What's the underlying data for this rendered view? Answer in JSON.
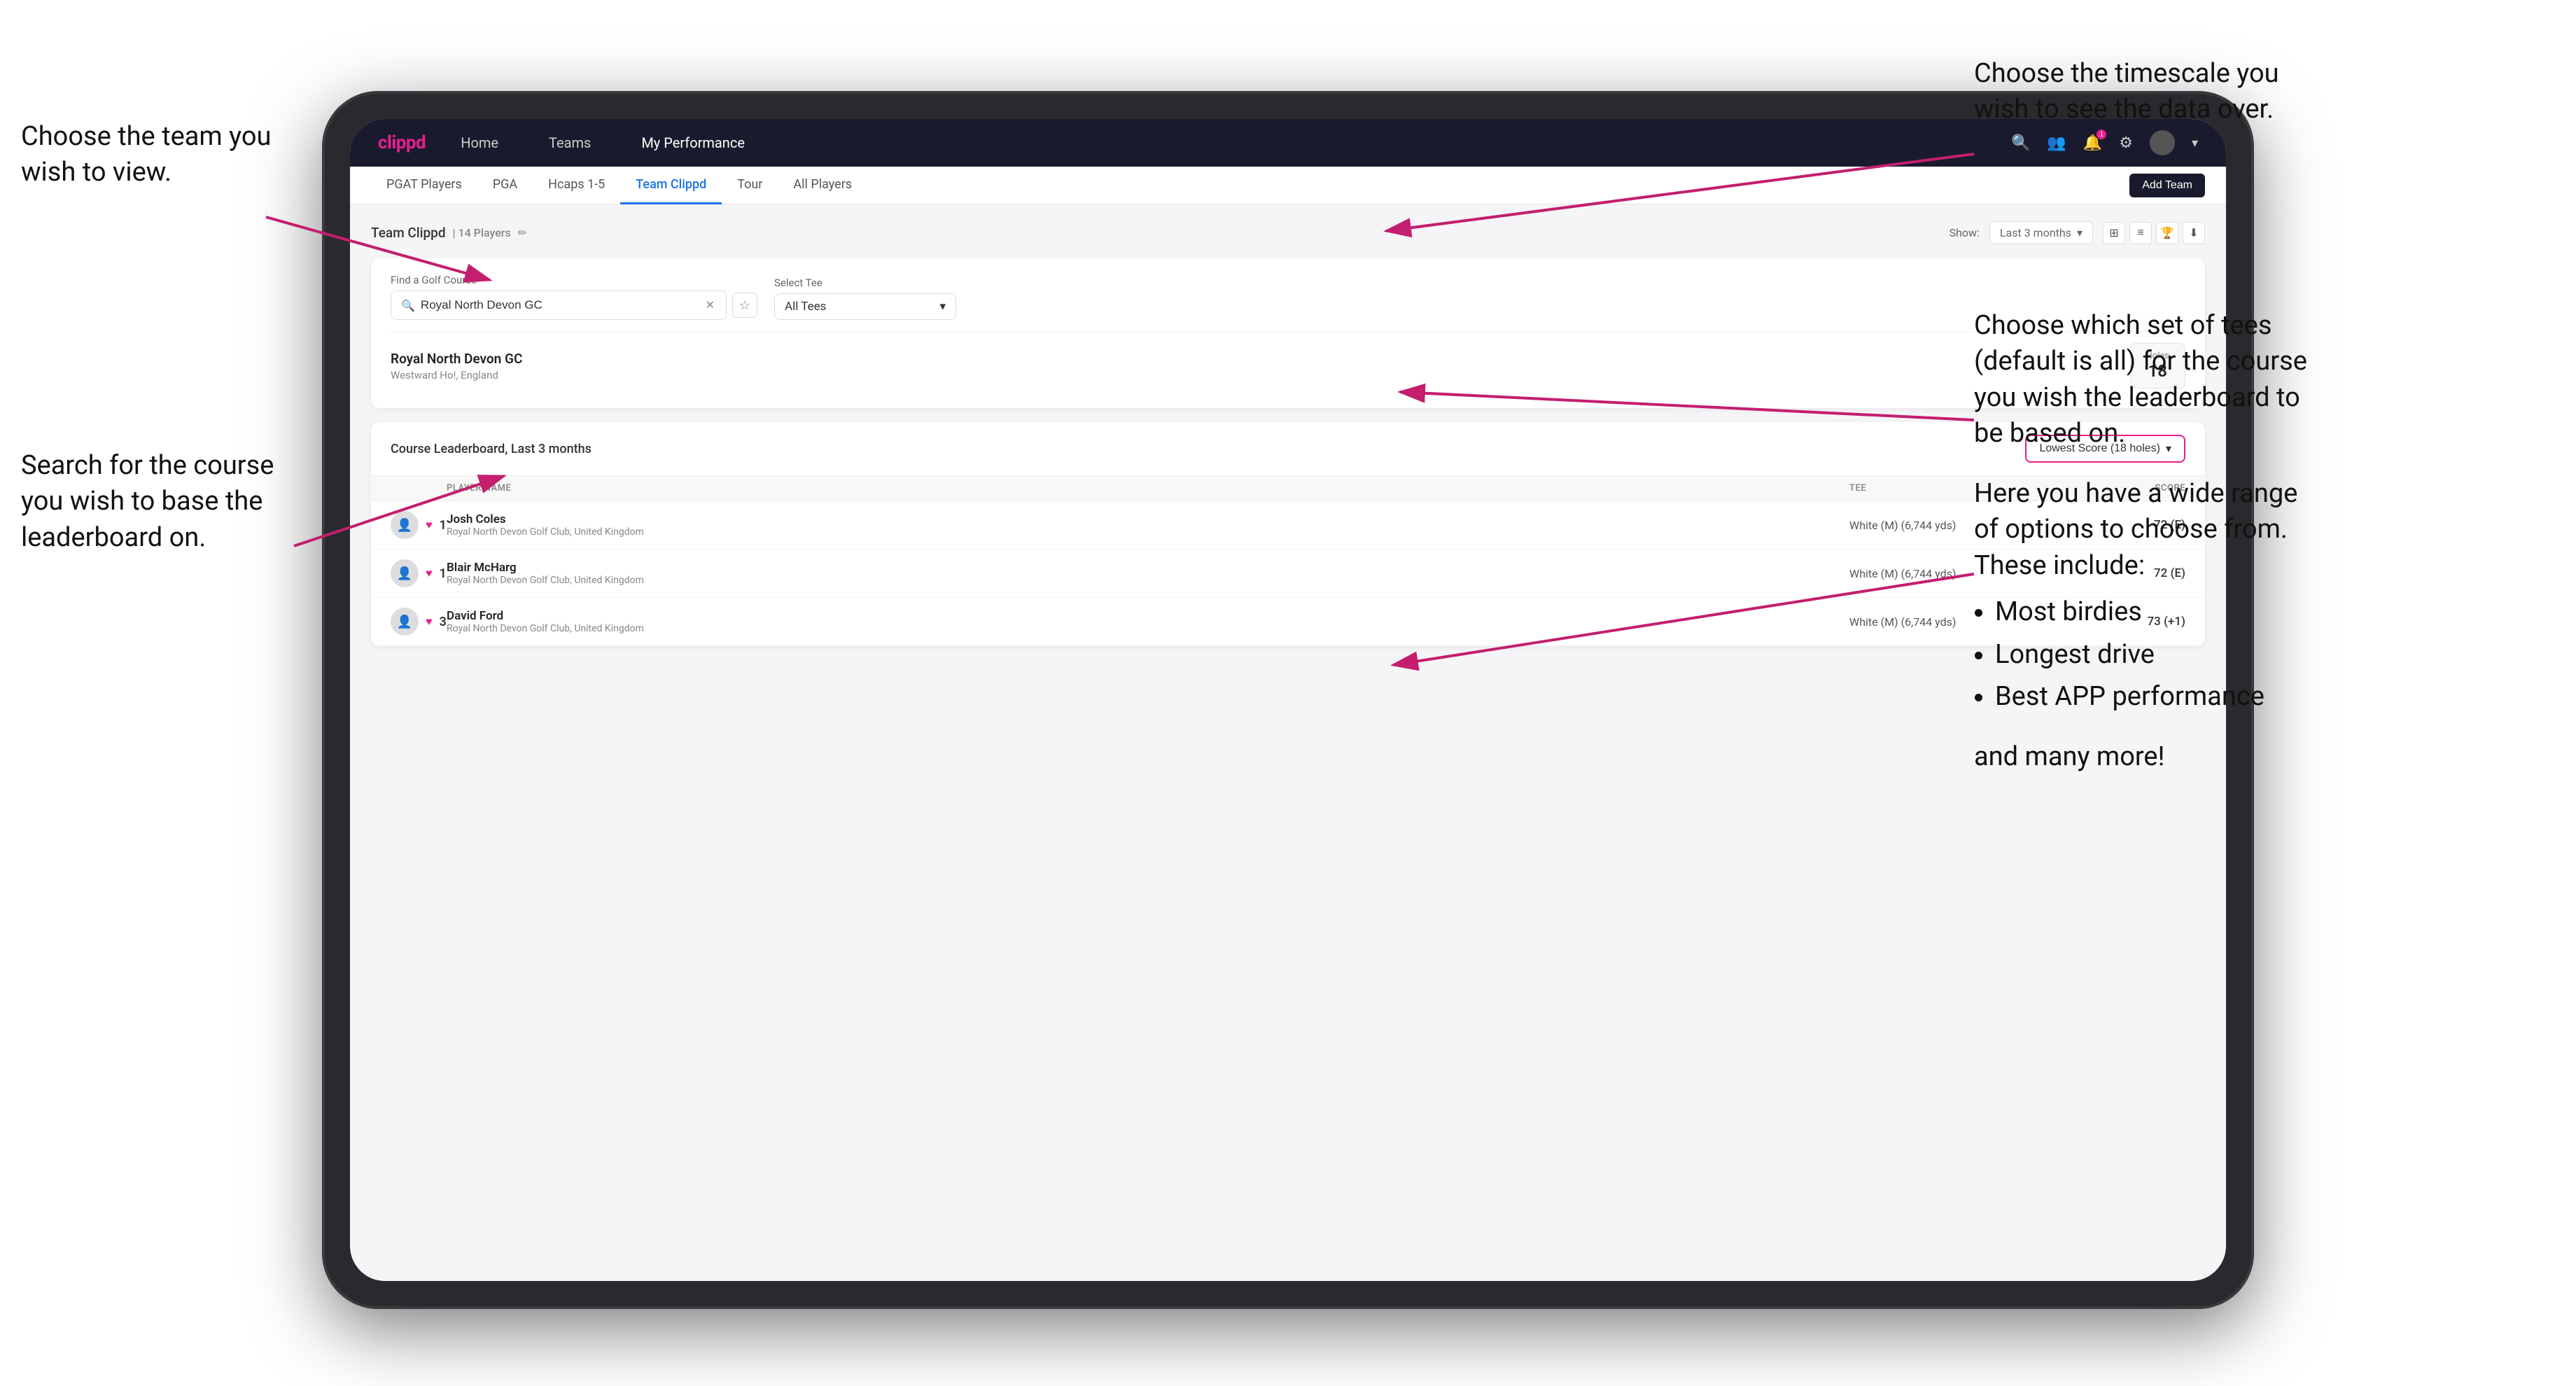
{
  "annotations": {
    "top_left_title": "Choose the team you",
    "top_left_sub": "wish to view.",
    "bottom_left_title": "Search for the course",
    "bottom_left_line2": "you wish to base the",
    "bottom_left_line3": "leaderboard on.",
    "top_right_title": "Choose the timescale you",
    "top_right_sub": "wish to see the data over.",
    "mid_right_title": "Choose which set of tees",
    "mid_right_sub": "(default is all) for the course",
    "mid_right_sub2": "you wish the leaderboard to",
    "mid_right_sub3": "be based on.",
    "far_right_title": "Here you have a wide range",
    "far_right_sub": "of options to choose from.",
    "far_right_sub2": "These include:",
    "bullet1": "Most birdies",
    "bullet2": "Longest drive",
    "bullet3": "Best APP performance",
    "and_more": "and many more!"
  },
  "navbar": {
    "logo": "clippd",
    "links": [
      "Home",
      "Teams",
      "My Performance"
    ],
    "active_link": "My Performance"
  },
  "subnav": {
    "tabs": [
      "PGAT Players",
      "PGA",
      "Hcaps 1-5",
      "Team Clippd",
      "Tour",
      "All Players"
    ],
    "active_tab": "Team Clippd",
    "add_team_label": "Add Team"
  },
  "team_header": {
    "title": "Team Clippd",
    "player_count": "14 Players",
    "show_label": "Show:",
    "time_period": "Last 3 months"
  },
  "course_search": {
    "find_label": "Find a Golf Course",
    "search_value": "Royal North Devon GC",
    "select_tee_label": "Select Tee",
    "tee_value": "All Tees",
    "course_name": "Royal North Devon GC",
    "course_location": "Westward Ho!, England",
    "holes_label": "Holes",
    "holes_value": "18"
  },
  "leaderboard": {
    "title": "Course Leaderboard,",
    "period": "Last 3 months",
    "score_type": "Lowest Score (18 holes)",
    "columns": [
      "PLAYER NAME",
      "TEE",
      "SCORE"
    ],
    "players": [
      {
        "rank": 1,
        "name": "Josh Coles",
        "club": "Royal North Devon Golf Club, United Kingdom",
        "tee": "White (M) (6,744 yds)",
        "score": "72 (E)"
      },
      {
        "rank": 1,
        "name": "Blair McHarg",
        "club": "Royal North Devon Golf Club, United Kingdom",
        "tee": "White (M) (6,744 yds)",
        "score": "72 (E)"
      },
      {
        "rank": 3,
        "name": "David Ford",
        "club": "Royal North Devon Golf Club, United Kingdom",
        "tee": "White (M) (6,744 yds)",
        "score": "73 (+1)"
      }
    ]
  },
  "icons": {
    "search": "🔍",
    "bell": "🔔",
    "person": "👤",
    "settings": "⚙",
    "chevron_down": "▾",
    "edit": "✏",
    "clear": "✕",
    "star": "☆",
    "grid": "⊞",
    "list": "≡",
    "trophy": "🏆",
    "download": "⬇",
    "heart": "♥"
  },
  "colors": {
    "brand_pink": "#e91e8c",
    "navy": "#1a1a2e",
    "blue": "#1a73e8"
  }
}
